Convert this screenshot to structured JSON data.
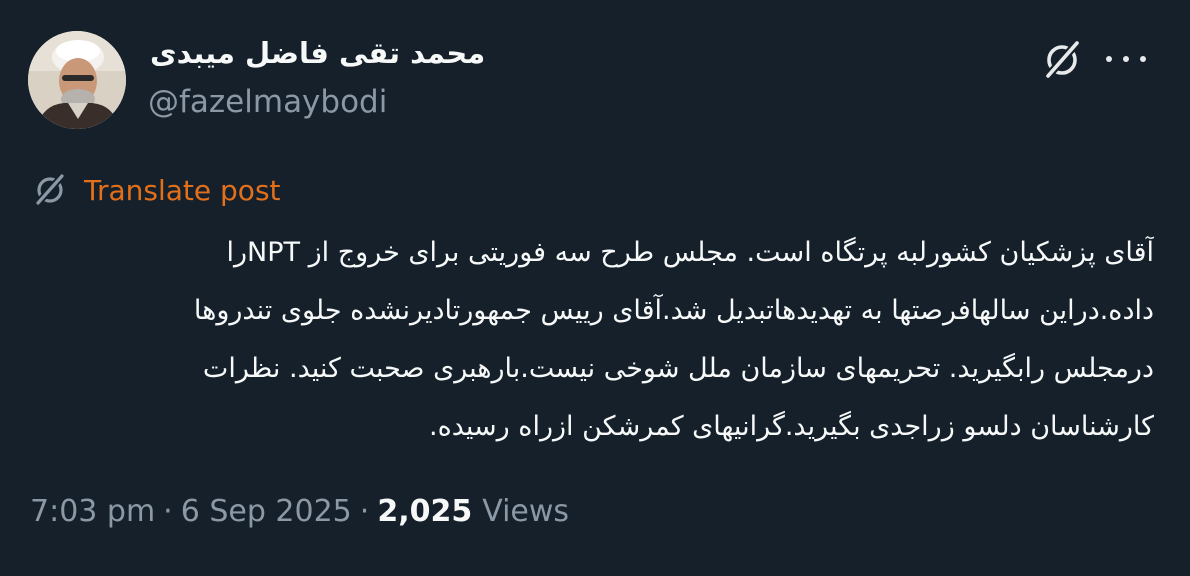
{
  "author": {
    "display_name": "محمد تقی فاضل میبدی",
    "handle": "@fazelmaybodi"
  },
  "header": {
    "grok_icon": "grok-slash-icon",
    "more_icon": "more-horizontal-icon"
  },
  "translate": {
    "icon": "grok-slash-icon",
    "label": "Translate post"
  },
  "post": {
    "lines": [
      "آقای پزشکیان کشورلبه پرتگاه است. مجلس طرح سه فوریتی برای خروج از NPTرا",
      "داده.دراین سالهافرصتها به تهدیدهاتبدیل شد.آقای رییس جمهورتادیرنشده جلوی تندروها",
      "درمجلس رابگیرید. تحریمهای سازمان ملل شوخی نیست.بارهبری صحبت کنید. نظرات",
      "کارشناسان دلسو زراجدی بگیرید.گرانیهای کمرشکن ازراه رسیده."
    ]
  },
  "meta": {
    "time": "7:03 pm",
    "separator": "·",
    "date": "6 Sep 2025",
    "views_count": "2,025",
    "views_label": "Views"
  },
  "colors": {
    "background": "#15202b",
    "text": "#f7f9f9",
    "secondary": "#8b98a5",
    "translate": "#e2701b"
  }
}
